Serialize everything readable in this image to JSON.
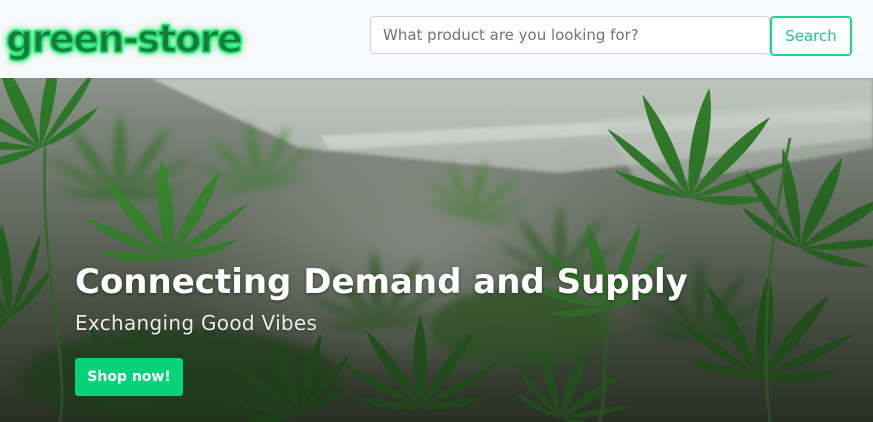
{
  "navbar": {
    "brand": "green-store",
    "search": {
      "placeholder": "What product are you looking for?",
      "value": "",
      "button_label": "Search"
    }
  },
  "hero": {
    "title": "Connecting Demand and Supply",
    "subtitle": "Exchanging Good Vibes",
    "cta_label": "Shop now!",
    "background_icon": "cannabis-plant-image"
  },
  "colors": {
    "navbar_bg": "#f8f9fa",
    "brand_glow": "#16e06a",
    "accent": "#06d27a",
    "search_border": "#1fd68a"
  }
}
